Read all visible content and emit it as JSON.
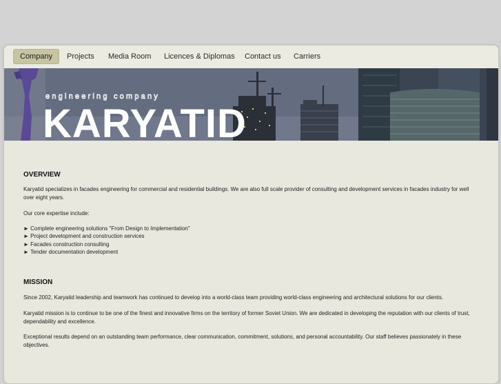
{
  "nav": {
    "items": [
      {
        "label": "Company",
        "active": true
      },
      {
        "label": "Projects",
        "active": false
      },
      {
        "label": "Media Room",
        "active": false
      },
      {
        "label": "Licences & Diplomas",
        "active": false
      },
      {
        "label": "Contact us",
        "active": false
      },
      {
        "label": "Carriers",
        "active": false
      }
    ]
  },
  "banner": {
    "tagline": "engineering company",
    "logo_text": "KARYATID"
  },
  "overview": {
    "heading": "OVERVIEW",
    "para1": "Karyatid specializes in facades engineering for commercial and residential buildings. We are also full scale provider of consulting and development  services in facades industry for well over eight years.",
    "expertise_intro": "Our core expertise include:",
    "bullets": [
      "► Complete engineering solutions \"From Design to Implementation\"",
      "► Project development and construction services",
      "► Facades construction consulting",
      "► Tender documentation development"
    ]
  },
  "mission": {
    "heading": "MISSION",
    "para1": "Since 2002, Karyatid leadership and teamwork has continued to develop into a world-class team providing world-class engineering and architectural solutions for our clients.",
    "para2": "Karyatid mission is to continue to be one of the finest and innovative firms on the territory of former Soviet Union. We are dedicated in developing the reputation with our clients of trust, dependability and excellence.",
    "para3": "Exceptional results depend on an outstanding team performance, clear communication, commitment, solutions, and personal accountability. Our staff believes passionately in these objectives."
  },
  "colors": {
    "background": "#d3d3d3",
    "panel": "#e8e8df",
    "active_tab": "#c7c4a1",
    "logo": "#ffffff",
    "statue": "#5a4a96"
  }
}
